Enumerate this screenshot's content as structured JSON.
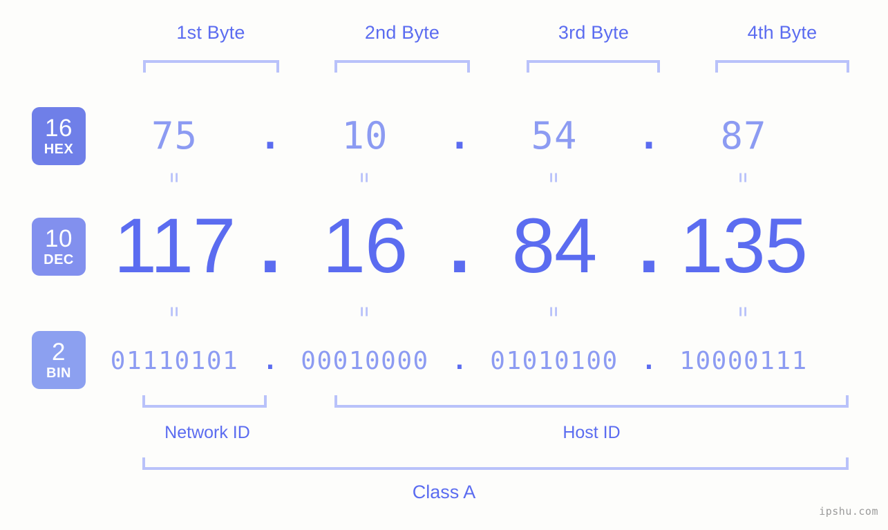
{
  "background_color": "#fdfdfb",
  "accent_color": "#5b6cf0",
  "light_accent_color": "#8c9bf2",
  "bracket_color": "#b9c2fa",
  "byte_headers": [
    {
      "label": "1st Byte"
    },
    {
      "label": "2nd Byte"
    },
    {
      "label": "3rd Byte"
    },
    {
      "label": "4th Byte"
    }
  ],
  "bases": [
    {
      "number": "16",
      "name": "HEX",
      "color": "#6f7fe8"
    },
    {
      "number": "10",
      "name": "DEC",
      "color": "#8290ee"
    },
    {
      "number": "2",
      "name": "BIN",
      "color": "#8ca0f0"
    }
  ],
  "separator": ".",
  "equals_mark": "=",
  "rows": {
    "hex": {
      "values": [
        "75",
        "10",
        "54",
        "87"
      ]
    },
    "dec": {
      "values": [
        "117",
        "16",
        "84",
        "135"
      ]
    },
    "bin": {
      "values": [
        "01110101",
        "00010000",
        "01010100",
        "10000111"
      ]
    }
  },
  "segments": {
    "network_id": "Network ID",
    "host_id": "Host ID",
    "class": "Class A"
  },
  "watermark": "ipshu.com"
}
